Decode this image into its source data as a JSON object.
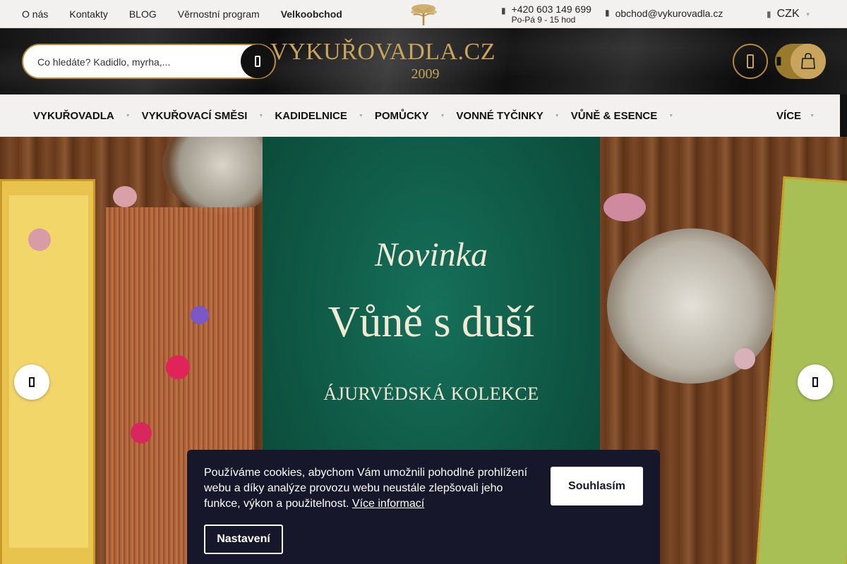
{
  "topbar": {
    "links": [
      "O nás",
      "Kontakty",
      "BLOG",
      "Věrnostní program",
      "Velkoobchod"
    ],
    "phone": "+420 603 149 699",
    "hours": "Po-Pá 9 - 15 hod",
    "email": "obchod@vykurovadla.cz",
    "currency": "CZK"
  },
  "header": {
    "logo_name": "VYKUŘOVADLA.CZ",
    "logo_year": "2009",
    "search_placeholder": "Co hledáte? Kadidlo, myrha,..."
  },
  "nav": {
    "items": [
      "VYKUŘOVADLA",
      "VYKUŘOVACÍ SMĚSI",
      "KADIDELNICE",
      "POMŮCKY",
      "VONNÉ TYČINKY",
      "VŮNĚ & ESENCE"
    ],
    "more": "VÍCE"
  },
  "hero": {
    "tag": "Novinka",
    "headline": "Vůně s duší",
    "collection": "ÁJURVÉDSKÁ KOLEKCE"
  },
  "cookie": {
    "text": "Používáme cookies, abychom Vám umožnili pohodlné prohlížení webu a díky analýze provozu webu neustále zlepšovali jeho funkce, výkon a použitelnost.",
    "more_link": "Více informací",
    "agree": "Souhlasím",
    "settings": "Nastavení"
  },
  "colors": {
    "gold": "#c9a45c",
    "cookie_bg": "#16172a",
    "hero_green": "#0f5a46",
    "topbar_bg": "#f2f1ef"
  }
}
